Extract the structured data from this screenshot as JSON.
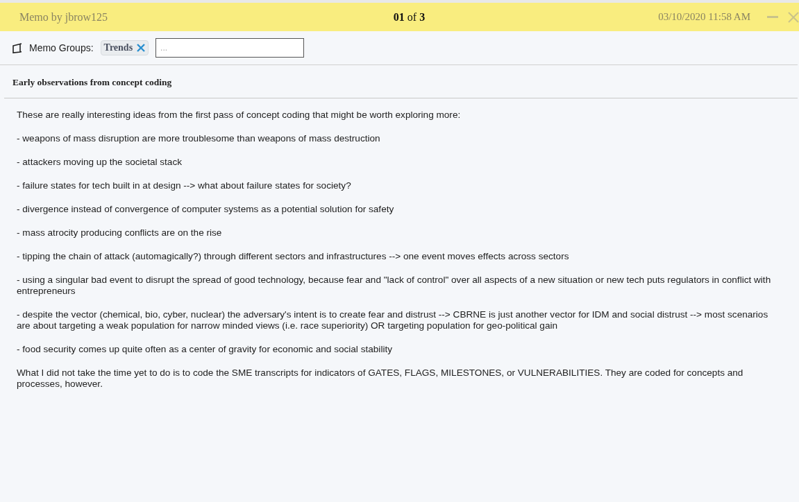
{
  "header": {
    "author": "Memo by jbrow125",
    "counter": "**01** of **3**",
    "timestamp": "03/10/2020 11:58 AM"
  },
  "groups": {
    "label": "Memo Groups:",
    "tags": [
      "Trends"
    ],
    "placeholder": "..."
  },
  "memo": {
    "title": "Early observations from concept coding",
    "paragraphs": [
      "These are really interesting ideas from the first pass of concept coding that might be worth exploring more:",
      "- weapons of mass disruption are more troublesome than weapons of mass destruction",
      "- attackers moving up the societal stack",
      "- failure states for tech built in at design --> what about failure states for society?",
      "- divergence instead of convergence of computer systems as a potential solution for safety",
      "- mass atrocity producing conflicts are on the rise",
      "- tipping the chain of attack (automagically?) through different sectors and infrastructures --> one event moves effects across sectors",
      "- using a singular bad event to disrupt the spread of good technology, because fear and \"lack of control\" over all aspects of a new situation or new tech puts regulators in conflict with entrepreneurs",
      "- despite the vector (chemical, bio, cyber, nuclear) the adversary's intent is to create fear and distrust --> CBRNE is just another vector for IDM and social distrust --> most scenarios are about targeting a weak population for narrow minded views (i.e. race superiority) OR targeting population for geo-political gain",
      "- food security comes up quite often as a center of gravity for economic and social stability",
      "What I did not take the time yet to do is to code the SME transcripts for indicators of GATES, FLAGS, MILESTONES, or VULNERABILITIES. They are coded for concepts and processes, however."
    ]
  }
}
